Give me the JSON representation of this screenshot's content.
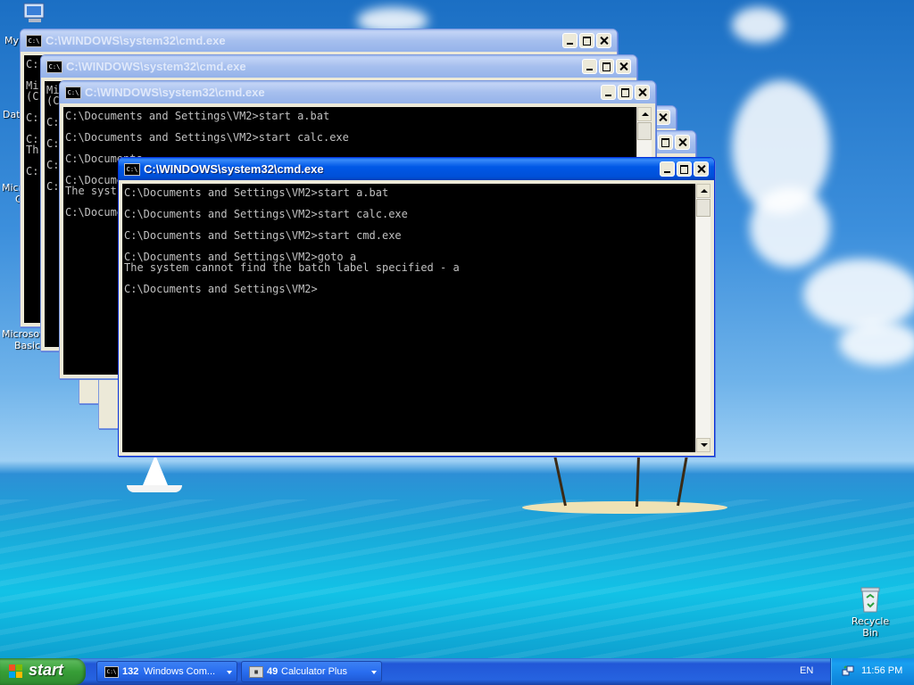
{
  "desktop": {
    "icons": [
      {
        "label": "My"
      },
      {
        "label": "Date"
      },
      {
        "label": "Microsoft"
      },
      {
        "label": "C"
      },
      {
        "label": "Microsoft"
      },
      {
        "label": "Basic"
      },
      {
        "label": "Recycle Bin"
      }
    ]
  },
  "windows": [
    {
      "title": "C:\\WINDOWS\\system32\\cmd.exe",
      "icon": "C:\\",
      "console": "C:\n\nMi\n(C\n\nC:\n\nC:\nTh\n\nC:"
    },
    {
      "title": "C:\\WINDOWS\\system32\\cmd.exe",
      "icon": "C:\\",
      "console": "Mi\n(C\n\nC:\n\nC:\n\nC:\n\nC:"
    },
    {
      "title": "C:\\WINDOWS\\system32\\cmd.exe",
      "icon": "C:\\",
      "console": "C:\\Documents and Settings\\VM2>start a.bat\n\nC:\\Documents and Settings\\VM2>start calc.exe\n\nC:\\Documents\n\nC:\\Documents\nThe syst\n\nC:\\Documents"
    },
    {
      "title": "",
      "icon": "",
      "console": ""
    },
    {
      "title": "",
      "icon": "",
      "console": ""
    },
    {
      "title": "C:\\WINDOWS\\system32\\cmd.exe",
      "icon": "C:\\",
      "console": "C:\\Documents and Settings\\VM2>start a.bat\n\nC:\\Documents and Settings\\VM2>start calc.exe\n\nC:\\Documents and Settings\\VM2>start cmd.exe\n\nC:\\Documents and Settings\\VM2>goto a\nThe system cannot find the batch label specified - a\n\nC:\\Documents and Settings\\VM2>"
    }
  ],
  "taskbar": {
    "start_label": "start",
    "groups": [
      {
        "count": "132",
        "label": "Windows Com...",
        "icon": "C:\\"
      },
      {
        "count": "49",
        "label": "Calculator Plus",
        "icon": "▦"
      }
    ],
    "language": "EN",
    "clock": "11:56 PM"
  },
  "colors": {
    "titlebar_active": "#0058e6",
    "titlebar_inactive": "#a6bfee",
    "console_bg": "#000000",
    "console_text": "#c0c0c0",
    "taskbar": "#2458d6",
    "start_button": "#379e37"
  }
}
